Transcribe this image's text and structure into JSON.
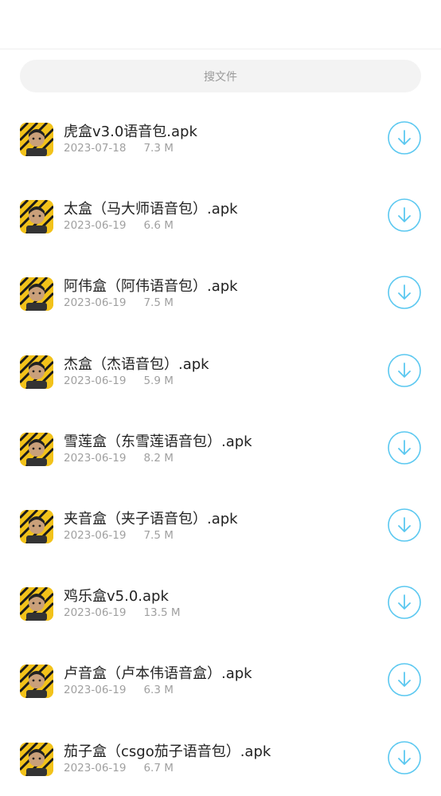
{
  "search": {
    "placeholder": "搜文件"
  },
  "files": [
    {
      "name": "虎盒v3.0语音包.apk",
      "date": "2023-07-18",
      "size": "7.3 M",
      "thumb": "tiger-box-app-icon"
    },
    {
      "name": "太盒（马大师语音包）.apk",
      "date": "2023-06-19",
      "size": "6.6 M",
      "thumb": "tai-box-app-icon"
    },
    {
      "name": "阿伟盒（阿伟语音包）.apk",
      "date": "2023-06-19",
      "size": "7.5 M",
      "thumb": "awei-box-app-icon"
    },
    {
      "name": "杰盒（杰语音包）.apk",
      "date": "2023-06-19",
      "size": "5.9 M",
      "thumb": "jie-box-app-icon"
    },
    {
      "name": "雪莲盒（东雪莲语音包）.apk",
      "date": "2023-06-19",
      "size": "8.2 M",
      "thumb": "xuelian-box-app-icon"
    },
    {
      "name": "夹音盒（夹子语音包）.apk",
      "date": "2023-06-19",
      "size": "7.5 M",
      "thumb": "jiayin-box-app-icon"
    },
    {
      "name": "鸡乐盒v5.0.apk",
      "date": "2023-06-19",
      "size": "13.5 M",
      "thumb": "jile-box-app-icon"
    },
    {
      "name": "卢音盒（卢本伟语音盒）.apk",
      "date": "2023-06-19",
      "size": "6.3 M",
      "thumb": "lu-box-app-icon"
    },
    {
      "name": "茄子盒（csgo茄子语音包）.apk",
      "date": "2023-06-19",
      "size": "6.7 M",
      "thumb": "qiezi-box-app-icon"
    }
  ],
  "colors": {
    "accent": "#5bc8f0",
    "thumb_bg": "#f2c21a"
  }
}
